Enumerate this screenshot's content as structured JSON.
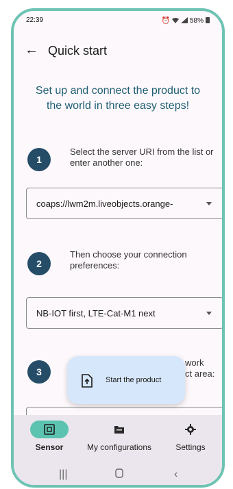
{
  "status_bar": {
    "time": "22:39",
    "battery": "58%"
  },
  "app_bar": {
    "title": "Quick start"
  },
  "intro": {
    "heading": "Set up and connect the product to the world in three easy steps!"
  },
  "steps": [
    {
      "number": "1",
      "text": "Select the server URI from the list or enter another one:"
    },
    {
      "number": "2",
      "text": "Then choose your connection preferences:"
    },
    {
      "number": "3",
      "text_tail_1": "work",
      "text_tail_2": "ct area:"
    }
  ],
  "selects": {
    "server_uri": {
      "value": "coaps://lwm2m.liveobjects.orange-"
    },
    "connection": {
      "value": "NB-IOT first, LTE-Cat-M1 next"
    }
  },
  "fab": {
    "label": "Start the product"
  },
  "bottom_nav": {
    "items": [
      {
        "label": "Sensor",
        "icon": "sensor-icon"
      },
      {
        "label": "My configurations",
        "icon": "folder-icon"
      },
      {
        "label": "Settings",
        "icon": "gear-icon"
      }
    ]
  },
  "colors": {
    "accent": "#5cc3b0",
    "badge": "#254d68",
    "heading": "#1f5e73",
    "fab": "#d7e7fb",
    "frame": "#6ec3b3"
  }
}
